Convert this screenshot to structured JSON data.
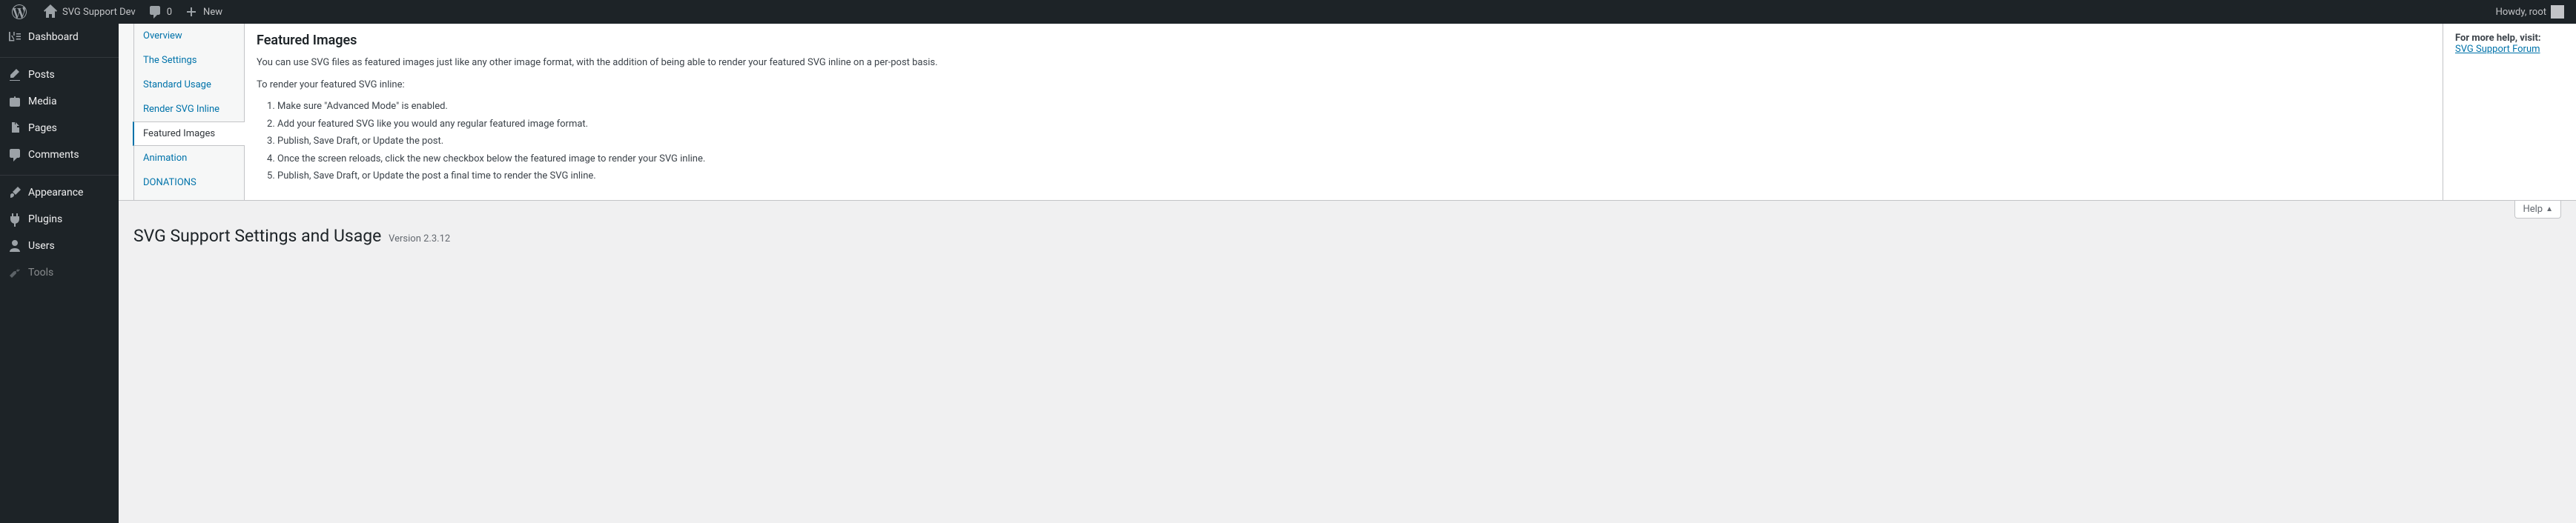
{
  "adminbar": {
    "site_name": "SVG Support Dev",
    "comments_count": "0",
    "new_label": "New",
    "howdy": "Howdy, root"
  },
  "sidebar": {
    "items": [
      {
        "label": "Dashboard"
      },
      {
        "label": "Posts"
      },
      {
        "label": "Media"
      },
      {
        "label": "Pages"
      },
      {
        "label": "Comments"
      },
      {
        "label": "Appearance"
      },
      {
        "label": "Plugins"
      },
      {
        "label": "Users"
      },
      {
        "label": "Tools"
      }
    ]
  },
  "help": {
    "tabs": [
      {
        "label": "Overview"
      },
      {
        "label": "The Settings"
      },
      {
        "label": "Standard Usage"
      },
      {
        "label": "Render SVG Inline"
      },
      {
        "label": "Featured Images"
      },
      {
        "label": "Animation"
      },
      {
        "label": "DONATIONS"
      }
    ],
    "title": "Featured Images",
    "intro": "You can use SVG files as featured images just like any other image format, with the addition of being able to render your featured SVG inline on a per-post basis.",
    "subintro": "To render your featured SVG inline:",
    "steps": [
      "Make sure \"Advanced Mode\" is enabled.",
      "Add your featured SVG like you would any regular featured image format.",
      "Publish, Save Draft, or Update the post.",
      "Once the screen reloads, click the new checkbox below the featured image to render your SVG inline.",
      "Publish, Save Draft, or Update the post a final time to render the SVG inline."
    ],
    "side_title": "For more help, visit:",
    "side_link": "SVG Support Forum",
    "toggle_label": "Help"
  },
  "page": {
    "title": "SVG Support Settings and Usage",
    "version": "Version 2.3.12"
  }
}
